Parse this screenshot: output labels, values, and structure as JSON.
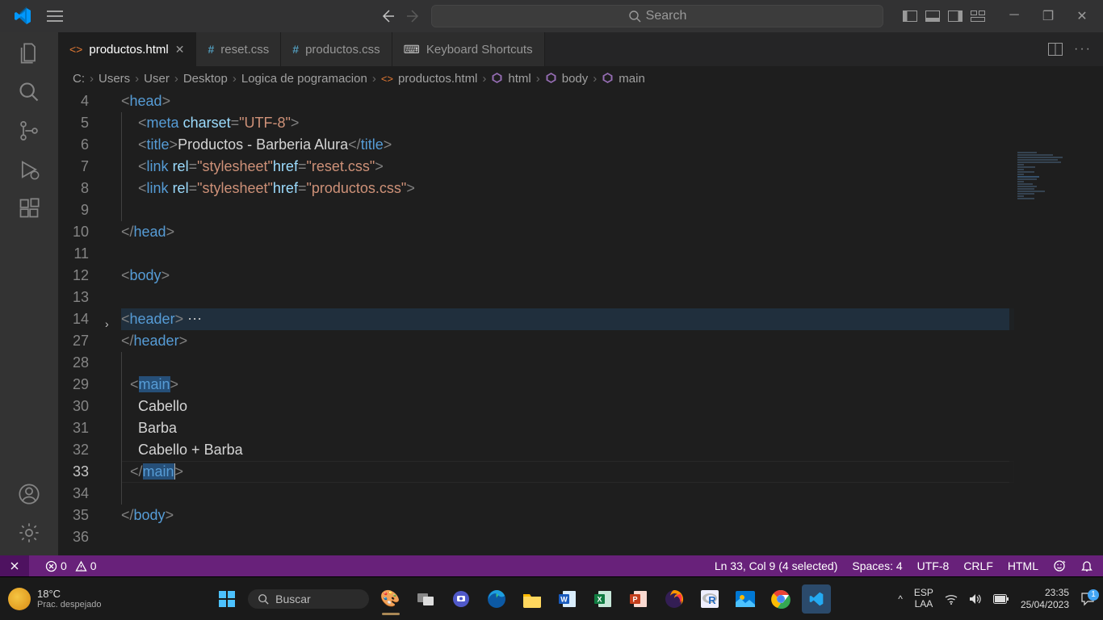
{
  "titlebar": {
    "search_placeholder": "Search"
  },
  "tabs": [
    {
      "label": "productos.html",
      "icon_color": "#e37933",
      "active": true,
      "closable": true
    },
    {
      "label": "reset.css",
      "icon_color": "#519aba",
      "active": false,
      "closable": false
    },
    {
      "label": "productos.css",
      "icon_color": "#519aba",
      "active": false,
      "closable": false
    },
    {
      "label": "Keyboard Shortcuts",
      "icon_color": "#c5c5c5",
      "active": false,
      "closable": false
    }
  ],
  "breadcrumb": {
    "path": [
      "C:",
      "Users",
      "User",
      "Desktop",
      "Logica de pogramacion"
    ],
    "file": "productos.html",
    "symbols": [
      "html",
      "body",
      "main"
    ]
  },
  "code": {
    "lines": [
      {
        "n": 4,
        "html": "<span class='c-punct'>&lt;</span><span class='c-tag'>head</span><span class='c-punct'>&gt;</span>"
      },
      {
        "n": 5,
        "html": "    <span class='c-punct'>&lt;</span><span class='c-tag'>meta</span> <span class='c-attr'>charset</span><span class='c-punct'>=</span><span class='c-str'>\"UTF-8\"</span><span class='c-punct'>&gt;</span>"
      },
      {
        "n": 6,
        "html": "    <span class='c-punct'>&lt;</span><span class='c-tag'>title</span><span class='c-punct'>&gt;</span><span class='c-txt'>Productos - Barberia Alura</span><span class='c-punct'>&lt;/</span><span class='c-tag'>title</span><span class='c-punct'>&gt;</span>"
      },
      {
        "n": 7,
        "html": "    <span class='c-punct'>&lt;</span><span class='c-tag'>link</span> <span class='c-attr'>rel</span><span class='c-punct'>=</span><span class='c-str'>\"stylesheet\"</span><span class='c-attr'>href</span><span class='c-punct'>=</span><span class='c-str'>\"reset.css\"</span><span class='c-punct'>&gt;</span>"
      },
      {
        "n": 8,
        "html": "    <span class='c-punct'>&lt;</span><span class='c-tag'>link</span> <span class='c-attr'>rel</span><span class='c-punct'>=</span><span class='c-str'>\"stylesheet\"</span><span class='c-attr'>href</span><span class='c-punct'>=</span><span class='c-str'>\"productos.css\"</span><span class='c-punct'>&gt;</span>"
      },
      {
        "n": 9,
        "html": ""
      },
      {
        "n": 10,
        "html": "<span class='c-punct'>&lt;/</span><span class='c-tag'>head</span><span class='c-punct'>&gt;</span>"
      },
      {
        "n": 11,
        "html": ""
      },
      {
        "n": 12,
        "html": "<span class='c-punct'>&lt;</span><span class='c-tag'>body</span><span class='c-punct'>&gt;</span>"
      },
      {
        "n": 13,
        "html": ""
      },
      {
        "n": 14,
        "html": "<span class='c-punct'>&lt;</span><span class='c-tag'>header</span><span class='c-punct'>&gt;</span> <span class='c-fold'>⋯</span>",
        "fold": true,
        "hl": true
      },
      {
        "n": 27,
        "html": "<span class='c-punct'>&lt;/</span><span class='c-tag'>header</span><span class='c-punct'>&gt;</span>"
      },
      {
        "n": 28,
        "html": ""
      },
      {
        "n": 29,
        "html": "  <span class='c-punct'>&lt;</span><span class='sel c-tag'>main</span><span class='c-punct'>&gt;</span>"
      },
      {
        "n": 30,
        "html": "    <span class='c-txt'>Cabello</span>"
      },
      {
        "n": 31,
        "html": "    <span class='c-txt'>Barba</span>"
      },
      {
        "n": 32,
        "html": "    <span class='c-txt'>Cabello + Barba</span>"
      },
      {
        "n": 33,
        "html": "  <span class='c-punct'>&lt;/</span><span class='sel c-tag'>main</span><span class='c-punct' style='border-left:1px solid #aeafad'>&gt;</span>",
        "current": true
      },
      {
        "n": 34,
        "html": ""
      },
      {
        "n": 35,
        "html": "<span class='c-punct'>&lt;/</span><span class='c-tag'>body</span><span class='c-punct'>&gt;</span>"
      },
      {
        "n": 36,
        "html": ""
      }
    ]
  },
  "status": {
    "errors": "0",
    "warnings": "0",
    "position": "Ln 33, Col 9 (4 selected)",
    "spaces": "Spaces: 4",
    "encoding": "UTF-8",
    "eol": "CRLF",
    "lang": "HTML"
  },
  "taskbar": {
    "temp": "18°C",
    "weather": "Prac. despejado",
    "search": "Buscar",
    "lang1": "ESP",
    "lang2": "LAA",
    "time": "23:35",
    "date": "25/04/2023",
    "notif": "1"
  }
}
